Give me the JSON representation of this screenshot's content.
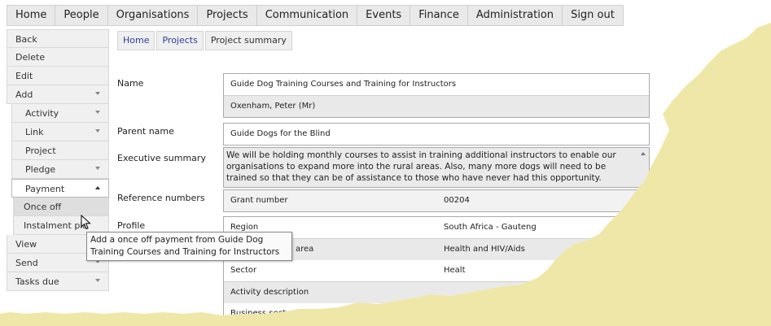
{
  "topnav": [
    "Home",
    "People",
    "Organisations",
    "Projects",
    "Communication",
    "Events",
    "Finance",
    "Administration",
    "Sign out"
  ],
  "sidebar": {
    "back": "Back",
    "delete": "Delete",
    "edit": "Edit",
    "add": "Add",
    "activity": "Activity",
    "link": "Link",
    "project": "Project",
    "pledge": "Pledge",
    "payment": "Payment",
    "once_off": "Once off",
    "instalment": "Instalment pla",
    "view": "View",
    "send": "Send",
    "tasks_due": "Tasks due"
  },
  "breadcrumb": [
    "Home",
    "Projects",
    "Project summary"
  ],
  "labels": {
    "name": "Name",
    "parent_name": "Parent name",
    "executive_summary": "Executive summary",
    "reference_numbers": "Reference numbers",
    "profile": "Profile"
  },
  "name_value": "Guide Dog Training Courses and Training for Instructors",
  "name_person": "Oxenham, Peter (Mr)",
  "parent_value": "Guide Dogs for the Blind",
  "summary_text": "We will be holding monthly courses to assist in training additional instructors to enable our organisations to expand more into the rural areas. Also, many more dogs will need to be trained so that they can be of assistance to those who have never had this opportunity.",
  "reference": {
    "key": "Grant number",
    "value": "00204"
  },
  "profile": [
    {
      "key": "Region",
      "value": "South Africa - Gauteng"
    },
    {
      "key": "area",
      "value": "Health and HIV/Aids"
    },
    {
      "key": "Sector",
      "value": "Healt"
    },
    {
      "key": "Activity description",
      "value": ""
    },
    {
      "key": "Business sector",
      "value": ""
    }
  ],
  "tooltip": "Add a once off payment from Guide Dog Training Courses and Training for Instructors",
  "colors": {
    "link": "#2d3e9a",
    "paper_edge": "#efe7a8"
  }
}
